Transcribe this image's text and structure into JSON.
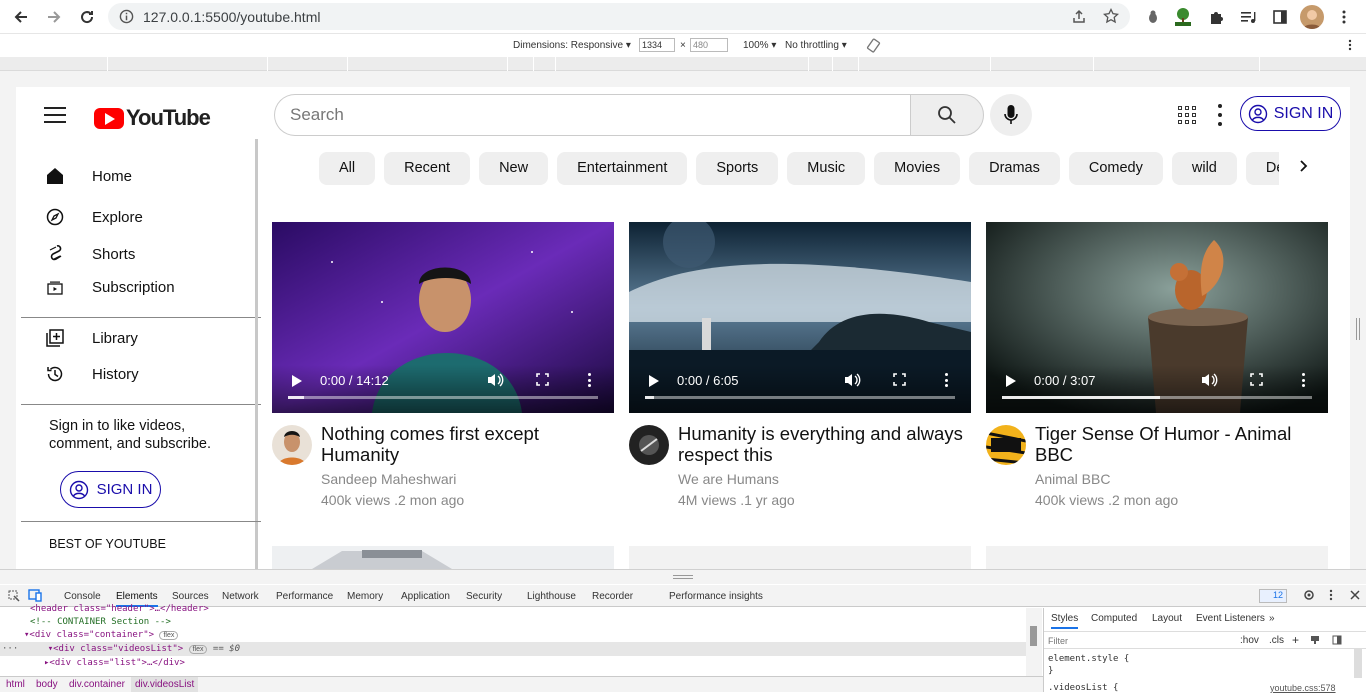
{
  "browser": {
    "url": "127.0.0.1:5500/youtube.html"
  },
  "device_toolbar": {
    "dimensions_label": "Dimensions: Responsive",
    "width": "1334",
    "times": "×",
    "height": "480",
    "zoom": "100%",
    "throttling": "No throttling"
  },
  "header": {
    "logo_text": "YouTube",
    "search_placeholder": "Search",
    "sign_in": "SIGN IN"
  },
  "sidebar": {
    "items": [
      {
        "label": "Home"
      },
      {
        "label": "Explore"
      },
      {
        "label": "Shorts"
      },
      {
        "label": "Subscription"
      },
      {
        "label": "Library"
      },
      {
        "label": "History"
      }
    ],
    "signin_note": "Sign in to like videos, comment, and subscribe.",
    "sign_in": "SIGN IN",
    "best_of": "BEST OF YOUTUBE"
  },
  "chips": [
    "All",
    "Recent",
    "New",
    "Entertainment",
    "Sports",
    "Music",
    "Movies",
    "Dramas",
    "Comedy",
    "wild",
    "Deba"
  ],
  "videos": [
    {
      "time": "0:00 / 14:12",
      "title": "Nothing comes first except Humanity",
      "channel": "Sandeep Maheshwari",
      "meta": "400k views .2 mon ago"
    },
    {
      "time": "0:00 / 6:05",
      "title": "Humanity is everything and always respect this",
      "channel": "We are Humans",
      "meta": "4M views .1 yr ago"
    },
    {
      "time": "0:00 / 3:07",
      "title": "Tiger Sense Of Humor - Animal BBC",
      "channel": "Animal BBC",
      "meta": "400k views .2 mon ago"
    }
  ],
  "devtools": {
    "tabs": [
      "Console",
      "Elements",
      "Sources",
      "Network",
      "Performance",
      "Memory",
      "Application",
      "Security",
      "Lighthouse",
      "Recorder",
      "Performance insights"
    ],
    "issues_count": "12",
    "dom_lines": {
      "l1": "<header class=\"header\">…</header>",
      "l2": "<!-- CONTAINER Section -->",
      "l3": "<div class=\"container\">",
      "l4": "<div class=\"videosList\">",
      "l4_suffix": "== $0",
      "l5": "<div class=\"list\">…</div>"
    },
    "flex_badge": "flex",
    "styles_tabs": [
      "Styles",
      "Computed",
      "Layout",
      "Event Listeners"
    ],
    "filter_placeholder": "Filter",
    "hov": ":hov",
    "cls": ".cls",
    "element_style": "element.style {",
    "close_brace": "}",
    "rule": ".videosList {",
    "source": "youtube.css:578",
    "breadcrumbs": [
      "html",
      "body",
      "div.container",
      "div.videosList"
    ]
  },
  "colors": {
    "brand_red": "#ff0000",
    "link_blue": "#1a0dab",
    "devtools_accent": "#1a73e8"
  }
}
